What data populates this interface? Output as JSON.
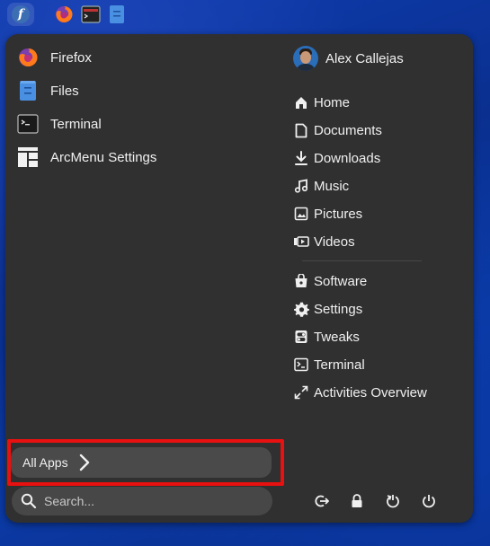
{
  "top_panel": {
    "icons": [
      "fedora-logo-icon",
      "firefox-icon",
      "terminal-icon",
      "files-icon"
    ],
    "fedora_glyph": "f"
  },
  "menu": {
    "pinned_apps": [
      {
        "label": "Firefox",
        "icon": "firefox-icon"
      },
      {
        "label": "Files",
        "icon": "files-icon"
      },
      {
        "label": "Terminal",
        "icon": "terminal-icon"
      },
      {
        "label": "ArcMenu Settings",
        "icon": "arcmenu-settings-icon"
      }
    ],
    "user": {
      "name": "Alex Callejas"
    },
    "places": [
      {
        "label": "Home",
        "icon": "home-icon"
      },
      {
        "label": "Documents",
        "icon": "document-icon"
      },
      {
        "label": "Downloads",
        "icon": "download-icon"
      },
      {
        "label": "Music",
        "icon": "music-icon"
      },
      {
        "label": "Pictures",
        "icon": "pictures-icon"
      },
      {
        "label": "Videos",
        "icon": "videos-icon"
      }
    ],
    "shortcuts": [
      {
        "label": "Software",
        "icon": "software-icon"
      },
      {
        "label": "Settings",
        "icon": "gear-icon"
      },
      {
        "label": "Tweaks",
        "icon": "tweaks-icon"
      },
      {
        "label": "Terminal",
        "icon": "terminal-icon"
      },
      {
        "label": "Activities Overview",
        "icon": "expand-icon"
      }
    ],
    "all_apps_label": "All Apps",
    "search_placeholder": "Search...",
    "power_icons": [
      "log-out-icon",
      "lock-icon",
      "restart-icon",
      "power-off-icon"
    ],
    "highlight_color": "#e81010"
  }
}
